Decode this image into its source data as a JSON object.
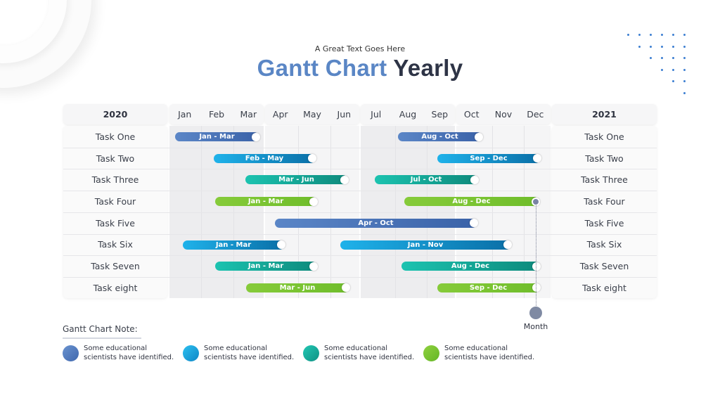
{
  "header": {
    "subtitle": "A Great Text Goes Here",
    "title_part1": "Gantt Chart",
    "title_part2": "Yearly"
  },
  "colors": {
    "title_accent": "#5a86c5",
    "title_dark": "#2e3446",
    "blue": "#4a74b8",
    "sky": "#1a9ed8",
    "teal": "#16a999",
    "green": "#7cc533",
    "month_marker": "#7f8aa3"
  },
  "chart_data": {
    "type": "gantt",
    "title": "Gantt Chart Yearly",
    "subtitle": "A Great Text Goes Here",
    "left_header": "2020",
    "right_header": "2021",
    "months": [
      "Jan",
      "Feb",
      "Mar",
      "Apr",
      "May",
      "Jun",
      "Jul",
      "Aug",
      "Sep",
      "Oct",
      "Nov",
      "Dec"
    ],
    "tasks": [
      {
        "name": "Task One",
        "bars": [
          {
            "label": "Jan - Mar",
            "color": "blue"
          },
          {
            "label": "Aug - Oct",
            "color": "blue"
          }
        ]
      },
      {
        "name": "Task Two",
        "bars": [
          {
            "label": "Feb - May",
            "color": "sky"
          },
          {
            "label": "Sep - Dec",
            "color": "sky"
          }
        ]
      },
      {
        "name": "Task Three",
        "bars": [
          {
            "label": "Mar - Jun",
            "color": "teal"
          },
          {
            "label": "Jul - Oct",
            "color": "teal"
          }
        ]
      },
      {
        "name": "Task Four",
        "bars": [
          {
            "label": "Jan - Mar",
            "color": "green"
          },
          {
            "label": "Aug - Dec",
            "color": "green"
          }
        ]
      },
      {
        "name": "Task Five",
        "bars": [
          {
            "label": "Apr - Oct",
            "color": "blue"
          }
        ]
      },
      {
        "name": "Task Six",
        "bars": [
          {
            "label": "Jan - Mar",
            "color": "sky"
          },
          {
            "label": "Jan - Nov",
            "color": "sky"
          }
        ]
      },
      {
        "name": "Task Seven",
        "bars": [
          {
            "label": "Jan - Mar",
            "color": "teal"
          },
          {
            "label": "Aug - Dec",
            "color": "teal"
          }
        ]
      },
      {
        "name": "Task eight",
        "bars": [
          {
            "label": "Mar - Jun",
            "color": "green"
          },
          {
            "label": "Sep - Dec",
            "color": "green"
          }
        ]
      }
    ],
    "marker": {
      "label": "Month"
    }
  },
  "notes": {
    "title": "Gantt Chart  Note:",
    "items": [
      {
        "color": "blue",
        "line1": "Some educational",
        "line2": "scientists have identified."
      },
      {
        "color": "sky",
        "line1": "Some educational",
        "line2": "scientists have identified."
      },
      {
        "color": "teal",
        "line1": "Some educational",
        "line2": "scientists have identified."
      },
      {
        "color": "green",
        "line1": "Some educational",
        "line2": "scientists have identified."
      }
    ]
  }
}
